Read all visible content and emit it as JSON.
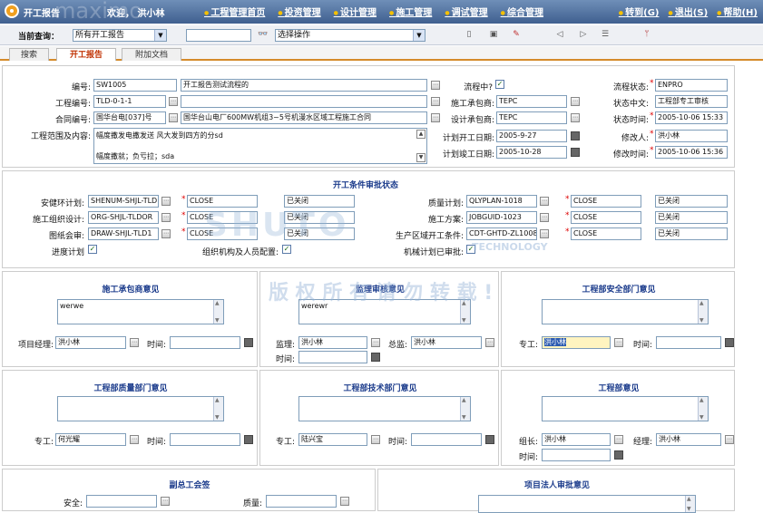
{
  "app": {
    "title": "开工报告",
    "welcome": "欢迎， 洪小林",
    "watermark_top": "maximo"
  },
  "nav": [
    "工程管理首页",
    "投资管理",
    "设计管理",
    "施工管理",
    "调试管理",
    "综合管理"
  ],
  "nav_right": [
    "转到(G)",
    "退出(S)",
    "帮助(H)"
  ],
  "query": {
    "label": "当前查询：",
    "query_value": "所有开工报告",
    "select_action": "选择操作"
  },
  "tabs": [
    "搜索",
    "开工报告",
    "附加文档"
  ],
  "header": {
    "code_label": "编号:",
    "code_value": "SW1005",
    "code_desc": "开工报告测试流程的",
    "proj_label": "工程编号:",
    "proj_value": "TLD-0-1-1",
    "contract_label": "合同编号:",
    "contract_value": "国华台电[037]号",
    "contract_desc": "国华台山电厂600MW机组3~5号机漫水区域工程施工合同",
    "scope_label": "工程范围及内容:",
    "scope_line1": "幅度撒发电撒发送 风大发到四方的分sd",
    "scope_line2": "幅度撒就；负亏拉；sda",
    "flow_label": "流程中?",
    "contractor_label": "施工承包商:",
    "contractor_value": "TEPC",
    "designer_label": "设计承包商:",
    "designer_value": "TEPC",
    "plan_start_label": "计划开工日期:",
    "plan_start_value": "2005-9-27",
    "plan_end_label": "计划竣工日期:",
    "plan_end_value": "2005-10-28",
    "status_label": "流程状态:",
    "status_value": "ENPRO",
    "status_cn_label": "状态中文:",
    "status_cn_value": "工程部专工审核",
    "status_time_label": "状态时间:",
    "status_time_value": "2005-10-06 15:33",
    "modifier_label": "修改人:",
    "modifier_value": "洪小林",
    "mod_time_label": "修改时间:",
    "mod_time_value": "2005-10-06 15:36"
  },
  "audit": {
    "title": "开工条件审批状态",
    "left_rows": [
      {
        "label": "安健环计划:",
        "code": "SHENUM-SHJL-TLD",
        "status": "CLOSE",
        "cn": "已关闭"
      },
      {
        "label": "施工组织设计:",
        "code": "ORG-SHJL-TLDOR",
        "status": "CLOSE",
        "cn": "已关闭"
      },
      {
        "label": "图纸会审:",
        "code": "DRAW-SHJL-TLD1",
        "status": "CLOSE",
        "cn": "已关闭"
      }
    ],
    "right_rows": [
      {
        "label": "质量计划:",
        "code": "QLYPLAN-1018",
        "status": "CLOSE",
        "cn": "已关闭"
      },
      {
        "label": "施工方案:",
        "code": "JOBGUID-1023",
        "status": "CLOSE",
        "cn": "已关闭"
      },
      {
        "label": "生产区域开工条件:",
        "code": "CDT-GHTD-ZL1008",
        "status": "CLOSE",
        "cn": "已关闭"
      }
    ],
    "progress_label": "进度计划",
    "org_label": "组织机构及人员配置:",
    "mech_label": "机械计划已审批:"
  },
  "panels": {
    "contractor": {
      "title": "施工承包商意见",
      "text": "werwe",
      "pm_label": "项目经理:",
      "pm_value": "洪小林",
      "time_label": "时间:"
    },
    "supervisor": {
      "title": "监理审核意见",
      "text": "werewr",
      "sup_label": "监理:",
      "sup_value": "洪小林",
      "chief_label": "总监:",
      "chief_value": "洪小林",
      "time_label": "时间:"
    },
    "safety": {
      "title": "工程部安全部门意见",
      "eng_label": "专工:",
      "eng_value": "洪小林",
      "time_label": "时间:"
    },
    "quality": {
      "title": "工程部质量部门意见",
      "eng_label": "专工:",
      "eng_value": "何光耀",
      "time_label": "时间:"
    },
    "tech": {
      "title": "工程部技术部门意见",
      "eng_label": "专工:",
      "eng_value": "陆兴宝",
      "time_label": "时间:"
    },
    "dept": {
      "title": "工程部意见",
      "leader_label": "组长:",
      "leader_value": "洪小林",
      "manager_label": "经理:",
      "manager_value": "洪小林",
      "time_label": "时间:"
    },
    "joint": {
      "title": "副总工会签",
      "safety_label": "安全:",
      "quality_label": "质量:"
    },
    "legal": {
      "title": "项目法人审批意见"
    }
  },
  "watermark": {
    "text": "版 权 所 有 请 勿 转 载 !",
    "brand": "SHUTO",
    "brand_sub": "TECHNOLOGY"
  }
}
